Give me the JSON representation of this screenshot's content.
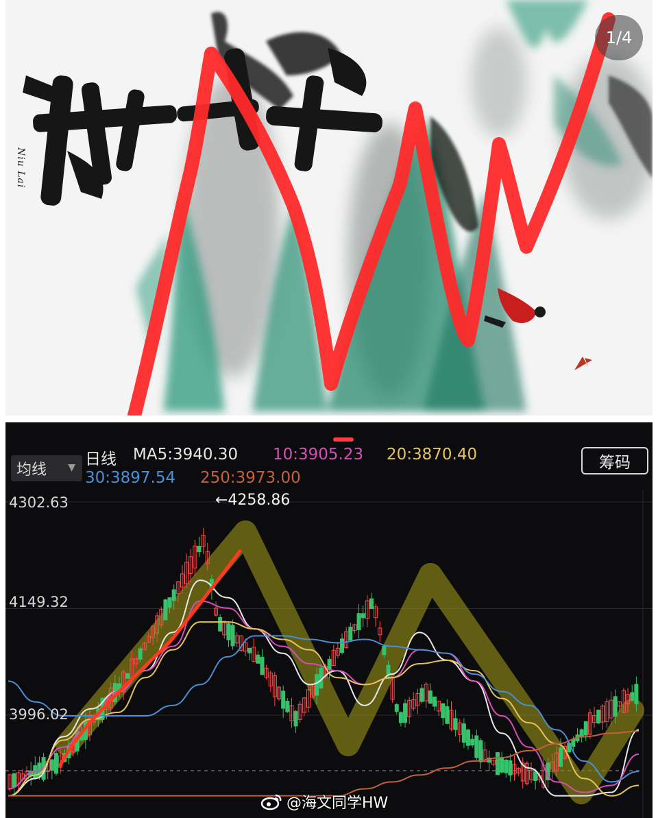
{
  "top_image": {
    "page_indicator": "1/4",
    "vertical_caption": "Niu Lai"
  },
  "chart_toolbar": {
    "ma_select_label": "均线",
    "period_label": "日线",
    "ma5": "MA5:3940.30",
    "ma10": "10:3905.23",
    "ma20": "20:3870.40",
    "ma30": "30:3897.54",
    "ma250": "250:3973.00",
    "chips_button": "筹码"
  },
  "colors": {
    "ma5": "#e8e8e8",
    "ma10": "#d54fb8",
    "ma20": "#e6c35a",
    "ma30": "#4a8fd6",
    "ma250": "#c4603c",
    "up_candle": "#ff4b4b",
    "down_candle": "#35c26a",
    "trend_overlay": "#ff3a1f",
    "zigzag_overlay": "#8f8a18"
  },
  "chart": {
    "y_labels": [
      "4302.63",
      "4149.32",
      "3996.02"
    ],
    "peak_annotation": "←4258.86"
  },
  "chart_data": {
    "type": "line",
    "title": "",
    "xlabel": "",
    "ylabel": "",
    "y_ticks": [
      4302.63,
      4149.32,
      3996.02
    ],
    "ylim": [
      3880,
      4330
    ],
    "peak": 4258.86,
    "grid": true,
    "series": [
      {
        "name": "MA5:3940.30",
        "values": [
          3880,
          3905,
          3965,
          4005,
          4030,
          4060,
          4115,
          4190,
          4165,
          4120,
          4085,
          4040,
          4060,
          4010,
          4055,
          4115,
          4075,
          4045,
          3970,
          3920,
          3880,
          3880,
          3885,
          3975
        ]
      },
      {
        "name": "10:3905.23",
        "values": [
          3890,
          3915,
          3950,
          3990,
          4030,
          4060,
          4095,
          4160,
          4150,
          4120,
          4095,
          4070,
          4060,
          4040,
          4050,
          4090,
          4085,
          4045,
          3995,
          3950,
          3900,
          3885,
          3895,
          3940
        ]
      },
      {
        "name": "20:3870.40",
        "values": [
          3880,
          3910,
          3960,
          3990,
          4000,
          4050,
          4090,
          4130,
          4130,
          4120,
          4105,
          4090,
          4050,
          4040,
          4050,
          4070,
          4075,
          4060,
          4020,
          3985,
          3955,
          3905,
          3880,
          3895
        ]
      },
      {
        "name": "30:3897.54",
        "values": [
          4045,
          4015,
          3995,
          3995,
          3995,
          3995,
          4010,
          4040,
          4080,
          4110,
          4110,
          4105,
          4100,
          4105,
          4095,
          4090,
          4085,
          4055,
          4030,
          4010,
          3975,
          3930,
          3900,
          3915
        ]
      },
      {
        "name": "250:3973.00",
        "values": [
          3880,
          3880,
          3880,
          3880,
          3880,
          3880,
          3880,
          3880,
          3880,
          3880,
          3880,
          3880,
          3880,
          3890,
          3900,
          3910,
          3920,
          3930,
          3935,
          3945,
          3955,
          3965,
          3970,
          3973
        ]
      }
    ]
  },
  "watermark": {
    "text": "@海文同学HW"
  }
}
